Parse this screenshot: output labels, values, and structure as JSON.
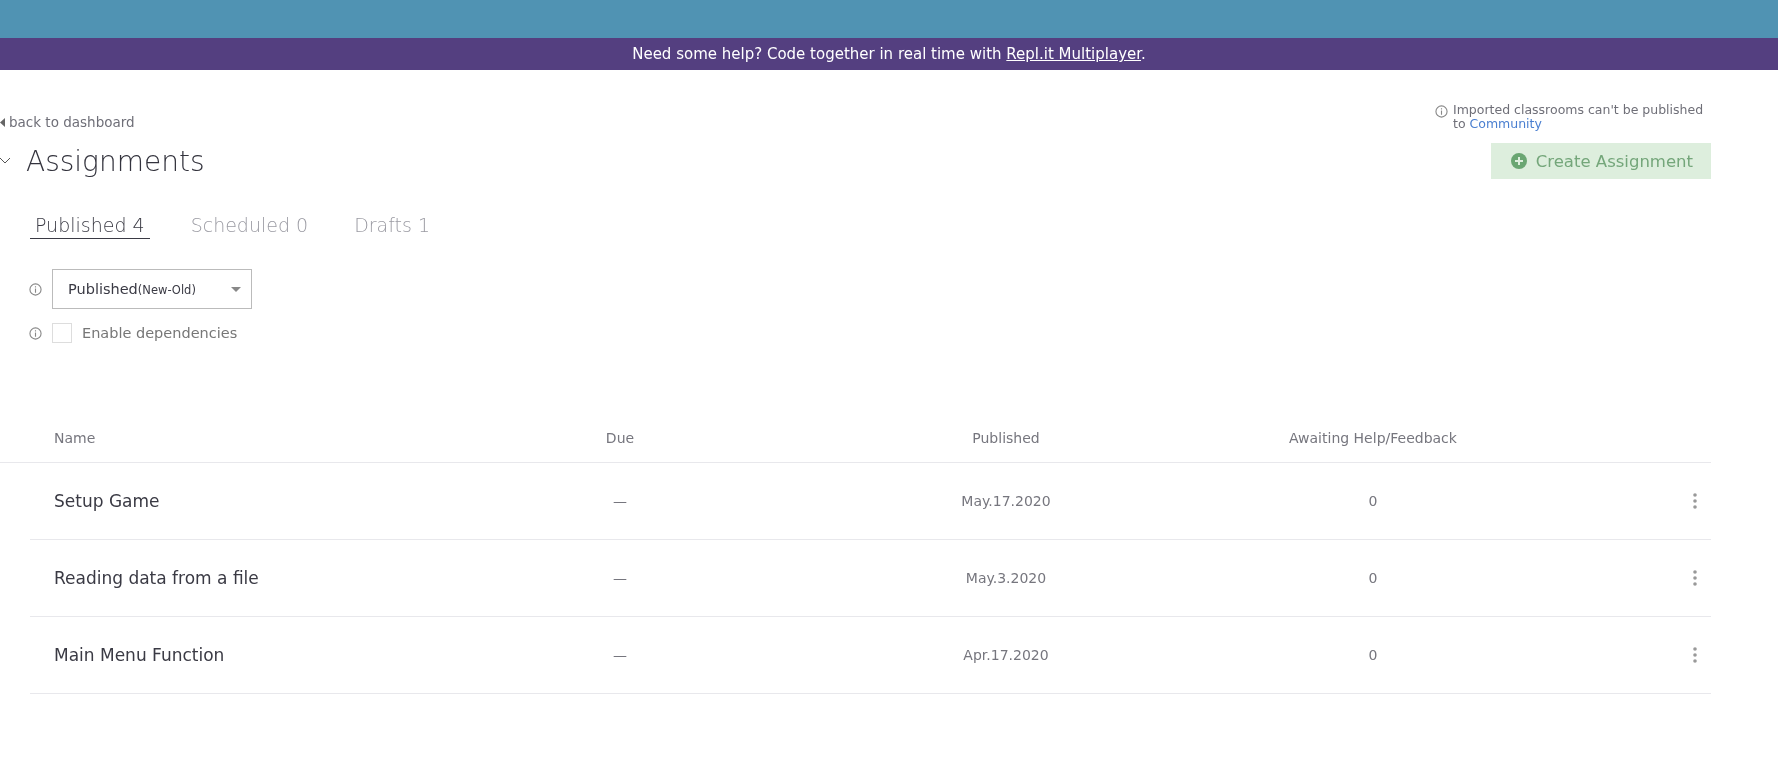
{
  "banner": {
    "text": "Need some help? Code together in real time with ",
    "link": "Repl.it Multiplayer",
    "suffix": "."
  },
  "back_link": "back to dashboard",
  "notice": {
    "text": "Imported classrooms can't be published to ",
    "link": "Community"
  },
  "section": {
    "title": "Assignments",
    "expanded": true
  },
  "create_button": "Create Assignment",
  "tabs": [
    {
      "label": "Published",
      "count": "4",
      "selected": true
    },
    {
      "label": "Scheduled",
      "count": "0",
      "selected": false
    },
    {
      "label": "Drafts",
      "count": "1",
      "selected": false
    }
  ],
  "sort_select": {
    "value": "Published",
    "suffix": "(New-Old)"
  },
  "dependencies": {
    "label": "Enable dependencies",
    "checked": false
  },
  "table": {
    "columns": [
      "Name",
      "Due",
      "Published",
      "Awaiting Help/Feedback"
    ],
    "rows": [
      {
        "name": "Setup Game",
        "due": "—",
        "published": "May.17.2020",
        "awaiting": "0"
      },
      {
        "name": "Reading data from a file",
        "due": "—",
        "published": "May.3.2020",
        "awaiting": "0"
      },
      {
        "name": "Main Menu Function",
        "due": "—",
        "published": "Apr.17.2020",
        "awaiting": "0"
      }
    ]
  }
}
